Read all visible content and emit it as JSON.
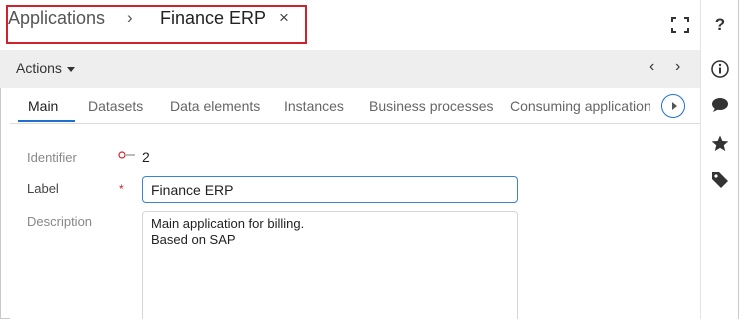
{
  "breadcrumb": {
    "parent": "Applications",
    "separator": "›",
    "current": "Finance ERP",
    "close": "×"
  },
  "actions": {
    "label": "Actions",
    "prev": "‹",
    "next": "›"
  },
  "tabs": [
    {
      "label": "Main",
      "active": true
    },
    {
      "label": "Datasets"
    },
    {
      "label": "Data elements"
    },
    {
      "label": "Instances"
    },
    {
      "label": "Business processes"
    },
    {
      "label": "Consuming applications"
    }
  ],
  "form": {
    "identifier_label": "Identifier",
    "identifier_value": "2",
    "label_label": "Label",
    "required_mark": "*",
    "label_value": "Finance ERP",
    "description_label": "Description",
    "description_value": "Main application for billing.\nBased on SAP"
  },
  "rail": {
    "help": "?"
  },
  "colors": {
    "accent": "#1f6fd1",
    "highlight_border": "#d0222c",
    "toolbar_bg": "#eeeeee"
  },
  "icons": [
    "fullscreen-icon",
    "help-icon",
    "info-icon",
    "comment-icon",
    "star-icon",
    "tag-icon",
    "chevron-down-icon",
    "chevron-left-icon",
    "chevron-right-icon",
    "close-icon",
    "scroll-right-icon"
  ]
}
